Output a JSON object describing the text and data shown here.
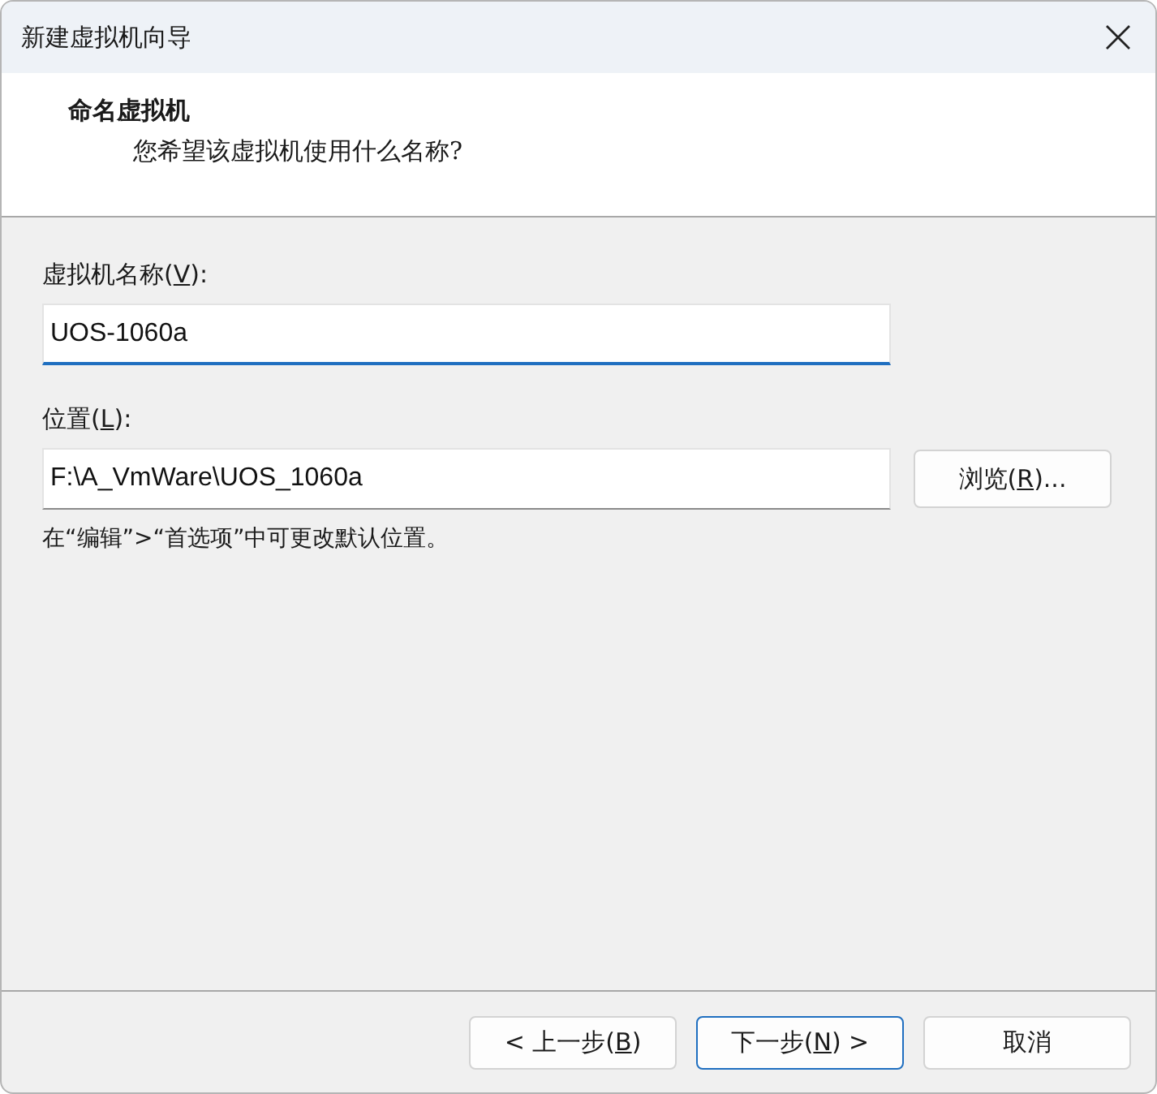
{
  "window": {
    "title": "新建虚拟机向导"
  },
  "header": {
    "title": "命名虚拟机",
    "subtitle": "您希望该虚拟机使用什么名称?"
  },
  "fields": [
    {
      "label": {
        "before": "虚拟机名称(",
        "access_key": "V",
        "after": "):"
      },
      "value": "UOS-1060a",
      "focused": true
    },
    {
      "label": {
        "before": "位置(",
        "access_key": "L",
        "after": "):"
      },
      "value": "F:\\A_VmWare\\UOS_1060a",
      "focused": false,
      "browse_button": {
        "before": "浏览(",
        "access_key": "R",
        "after": ")..."
      }
    }
  ],
  "hint": "在“编辑”>“首选项”中可更改默认位置。",
  "buttons": [
    {
      "before": "< 上一步(",
      "access_key": "B",
      "after": ")",
      "default": false
    },
    {
      "before": "下一步(",
      "access_key": "N",
      "after": ") >",
      "default": true
    },
    {
      "before": "取消",
      "default": false
    }
  ]
}
